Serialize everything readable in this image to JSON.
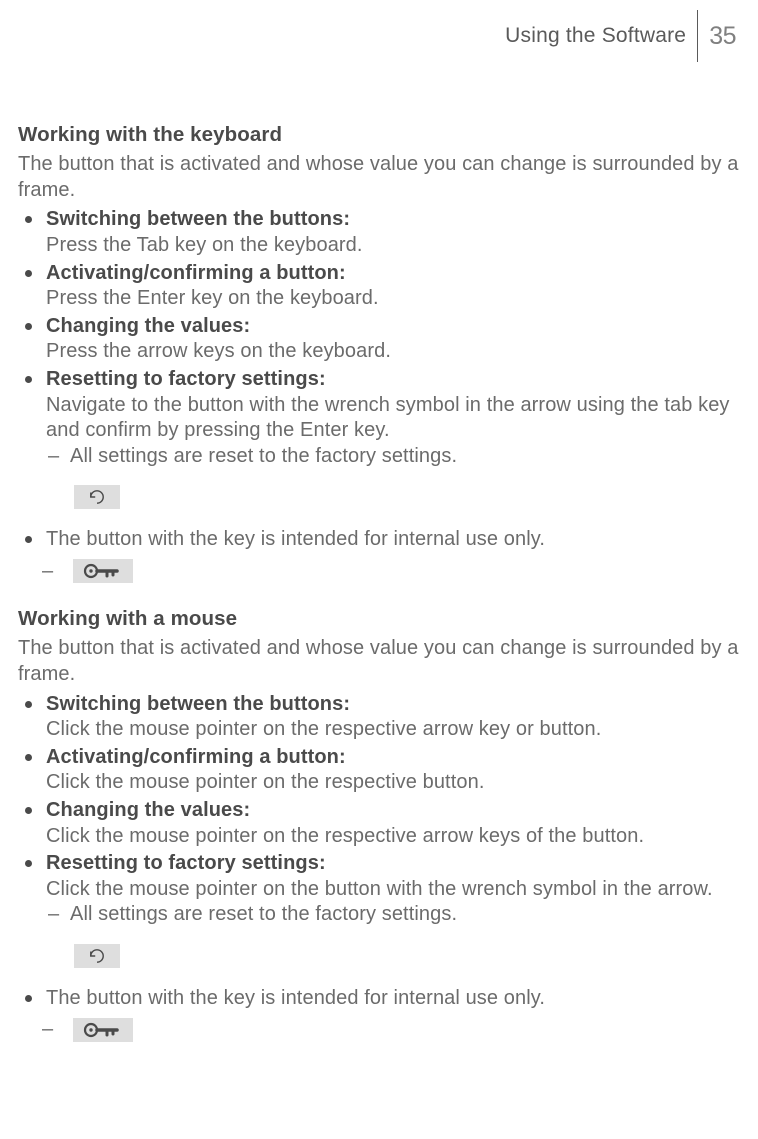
{
  "header": {
    "title": "Using the Software",
    "page": "35"
  },
  "s1": {
    "heading": "Working with the keyboard",
    "intro": "The button that is activated and whose value you can change is surrounded by a frame.",
    "items": [
      {
        "bold": "Switching between the buttons:",
        "text": "Press the Tab key on the keyboard."
      },
      {
        "bold": "Activating/confirming a button:",
        "text": "Press the Enter key on the keyboard."
      },
      {
        "bold": "Changing the values:",
        "text": "Press the arrow keys on the keyboard."
      },
      {
        "bold": "Resetting to factory settings:",
        "text": "Navigate to the button with the wrench symbol in the arrow using the tab key and confirm by pressing the Enter key.",
        "sub": "All settings are reset to the factory settings."
      }
    ],
    "tail": "The button with the key is intended for internal use only."
  },
  "s2": {
    "heading": "Working with a mouse",
    "intro": "The button that is activated and whose value you can change is surrounded by a frame.",
    "items": [
      {
        "bold": "Switching between the buttons:",
        "text": "Click the mouse pointer on the respective arrow key or button."
      },
      {
        "bold": "Activating/confirming a button:",
        "text": "Click the mouse pointer on the respective button."
      },
      {
        "bold": "Changing the values:",
        "text": "Click the mouse pointer on the respective arrow keys of the button."
      },
      {
        "bold": "Resetting to factory settings:",
        "text": "Click the mouse pointer on the button with the wrench symbol in the arrow.",
        "sub": "All settings are reset to the factory settings."
      }
    ],
    "tail": "The button with the key is intended for internal use only."
  }
}
